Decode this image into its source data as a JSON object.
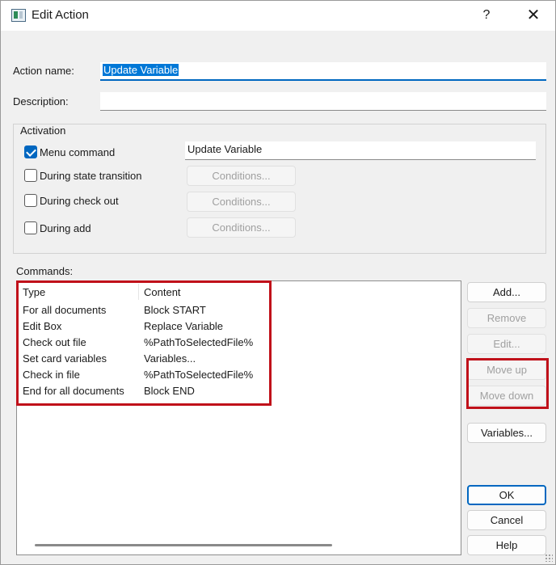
{
  "window": {
    "title": "Edit Action",
    "help_label": "?",
    "close_label": "✕"
  },
  "form": {
    "action_name_label": "Action name:",
    "action_name_value": "Update Variable",
    "description_label": "Description:",
    "description_value": ""
  },
  "activation": {
    "title": "Activation",
    "menu_command": {
      "label": "Menu command",
      "checked": true,
      "value": "Update Variable"
    },
    "during_state_transition": {
      "label": "During state transition",
      "checked": false,
      "button": "Conditions..."
    },
    "during_check_out": {
      "label": "During check out",
      "checked": false,
      "button": "Conditions..."
    },
    "during_add": {
      "label": "During add",
      "checked": false,
      "button": "Conditions..."
    }
  },
  "commands": {
    "label": "Commands:",
    "columns": [
      "Type",
      "Content"
    ],
    "rows": [
      {
        "type": "For all documents",
        "content": "Block START"
      },
      {
        "type": "Edit Box",
        "content": "Replace Variable"
      },
      {
        "type": "Check out file",
        "content": "%PathToSelectedFile%"
      },
      {
        "type": "Set card variables",
        "content": "Variables..."
      },
      {
        "type": "Check in file",
        "content": "%PathToSelectedFile%"
      },
      {
        "type": "End for all documents",
        "content": "Block END"
      }
    ]
  },
  "buttons": {
    "add": "Add...",
    "remove": "Remove",
    "edit": "Edit...",
    "move_up": "Move up",
    "move_down": "Move down",
    "variables": "Variables...",
    "ok": "OK",
    "cancel": "Cancel",
    "help": "Help"
  },
  "colors": {
    "accent": "#0067c0",
    "highlight": "#c0111a",
    "selection": "#0078d7"
  },
  "icons": {
    "app": "window-icon",
    "close": "close-icon",
    "check": "checkmark-icon"
  }
}
